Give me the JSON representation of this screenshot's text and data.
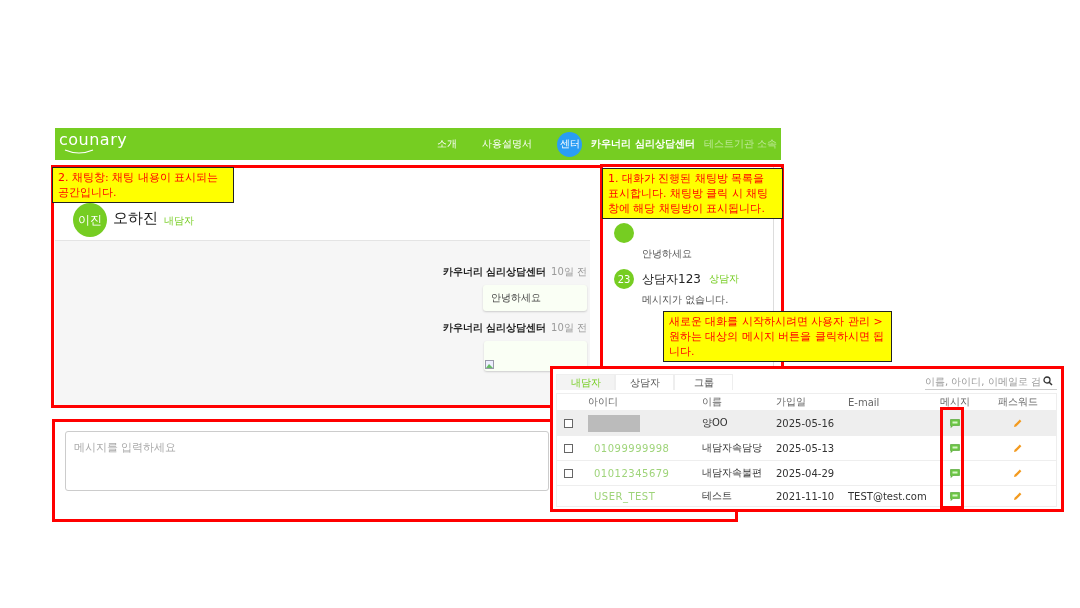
{
  "header": {
    "logo": "counary",
    "nav": [
      "소개",
      "사용설명서"
    ],
    "badge": "센터",
    "center_name": "카우너리 심리상담센터",
    "affiliation": "테스트기관 소속"
  },
  "chat_window": {
    "avatar": "이진",
    "name": "오하진",
    "role": "내담자",
    "messages": [
      {
        "sender": "카우너리 심리상담센터",
        "time": "10일 전",
        "kind": "text",
        "text": "안녕하세요"
      },
      {
        "sender": "카우너리 심리상담센터",
        "time": "10일 전",
        "kind": "image"
      }
    ]
  },
  "room_list": {
    "rooms": [
      {
        "preview": "안녕하세요"
      },
      {
        "avatar": "23",
        "name": "상담자123",
        "role": "상담자",
        "preview": "메시지가 없습니다."
      }
    ]
  },
  "message_input": {
    "placeholder": "메시지를 입력하세요"
  },
  "user_table": {
    "tabs": [
      {
        "label": "내담자",
        "selected": true
      },
      {
        "label": "상담자",
        "selected": false
      },
      {
        "label": "그룹",
        "selected": false
      }
    ],
    "search": {
      "placeholder": "이름, 아이디, 이메일로 검"
    },
    "columns": [
      "아이디",
      "이름",
      "가입일",
      "E-mail",
      "메시지",
      "패스워드"
    ],
    "rows": [
      {
        "selected": true,
        "checked": false,
        "id_masked": true,
        "name": "양OO",
        "joined": "2025-05-16"
      },
      {
        "selected": false,
        "checked": false,
        "id": "01099999998",
        "name": "내담자속담당",
        "joined": "2025-05-13"
      },
      {
        "selected": false,
        "checked": false,
        "id": "01012345679",
        "name": "내담자속불편",
        "joined": "2025-04-29"
      },
      {
        "selected": false,
        "id": "USER_TEST",
        "name": "테스트",
        "joined": "2021-11-10",
        "email": "TEST@test.com"
      }
    ]
  },
  "callouts": [
    {
      "text": "2. 채팅창: 채팅 내용이 표시되는 공간입니다."
    },
    {
      "text": "1. 대화가 진행된 채팅방 목록을 표시합니다. 채팅방 클릭 시 채팅창에 해당 채팅방이 표시됩니다."
    },
    {
      "text": "새로운 대화를 시작하시려면 사용자 관리 > 원하는 대상의 메시지 버튼을 클릭하시면 됩니다."
    }
  ]
}
